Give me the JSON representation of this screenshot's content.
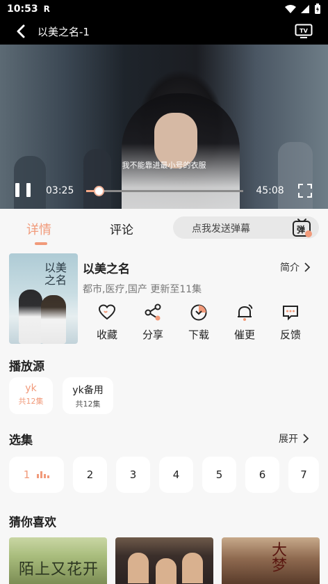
{
  "status_bar": {
    "time": "10:53",
    "carrier_icon": "R"
  },
  "player": {
    "title": "以美之名-1",
    "subtitle": "我不能靠进最小号的衣服",
    "current_time": "03:25",
    "total_time": "45:08",
    "progress": 0.076
  },
  "tabs": {
    "detail": "详情",
    "comment": "评论"
  },
  "danmu": {
    "placeholder": "点我发送弹幕",
    "icon_text": "弹"
  },
  "show": {
    "name": "以美之名",
    "poster_title": "以美之名",
    "brief_label": "简介",
    "meta": "都市,医疗,国产 更新至11集"
  },
  "actions": [
    {
      "label": "收藏",
      "icon": "heart-icon"
    },
    {
      "label": "分享",
      "icon": "share-icon"
    },
    {
      "label": "下载",
      "icon": "download-icon"
    },
    {
      "label": "催更",
      "icon": "bell-icon"
    },
    {
      "label": "反馈",
      "icon": "feedback-icon"
    }
  ],
  "sources": {
    "title": "播放源",
    "items": [
      {
        "name": "yk",
        "count": "共12集"
      },
      {
        "name": "yk备用",
        "count": "共12集"
      }
    ]
  },
  "episodes": {
    "title": "选集",
    "expand_label": "展开",
    "items": [
      "1",
      "2",
      "3",
      "4",
      "5",
      "6",
      "7"
    ]
  },
  "recommend": {
    "title": "猜你喜欢",
    "items": [
      {
        "text": "陌上又花开"
      },
      {
        "text": ""
      },
      {
        "text": "大梦"
      }
    ]
  },
  "colors": {
    "accent": "#f19a7a",
    "background": "#f7f7f7"
  }
}
